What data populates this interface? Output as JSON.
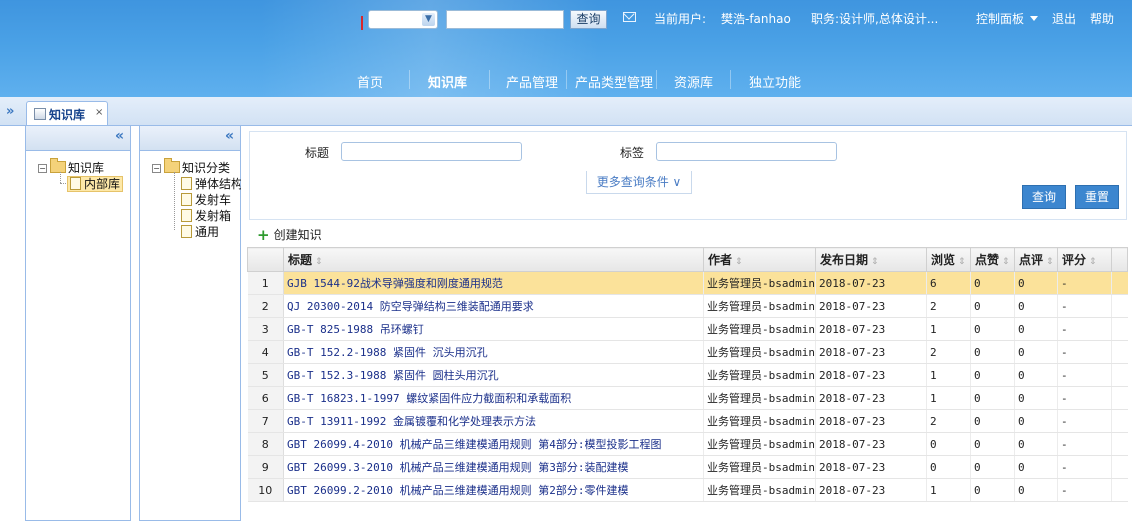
{
  "header": {
    "search_button": "查询",
    "user_label": "当前用户:",
    "user_name": "樊浩-fanhao",
    "role": "职务:设计师,总体设计...",
    "control_panel": "控制面板",
    "logout": "退出",
    "help": "帮助",
    "nav": [
      "首页",
      "知识库",
      "产品管理",
      "产品类型管理",
      "资源库",
      "独立功能"
    ],
    "active_nav": "知识库"
  },
  "tabs": [
    {
      "label": "知识库",
      "close": "×"
    }
  ],
  "left_tree": {
    "root": "知识库",
    "children": [
      "内部库"
    ],
    "selected": "内部库"
  },
  "category_tree": {
    "root": "知识分类",
    "children": [
      "弹体结构",
      "发射车",
      "发射箱",
      "通用"
    ]
  },
  "filter": {
    "title_label": "标题",
    "title_value": "",
    "tag_label": "标签",
    "tag_value": "",
    "more_conditions": "更多查询条件 ∨",
    "query_button": "查询",
    "reset_button": "重置"
  },
  "create_label": "创建知识",
  "grid": {
    "columns": [
      "标题",
      "作者",
      "发布日期",
      "浏览",
      "点赞",
      "点评",
      "评分"
    ],
    "rows": [
      {
        "n": "1",
        "title": "GJB 1544-92战术导弹强度和刚度通用规范",
        "author": "业务管理员-bsadmin",
        "date": "2018-07-23",
        "views": "6",
        "likes": "0",
        "comments": "0",
        "score": "-"
      },
      {
        "n": "2",
        "title": "QJ 20300-2014 防空导弹结构三维装配通用要求",
        "author": "业务管理员-bsadmin",
        "date": "2018-07-23",
        "views": "2",
        "likes": "0",
        "comments": "0",
        "score": "-"
      },
      {
        "n": "3",
        "title": "GB-T 825-1988 吊环螺钉",
        "author": "业务管理员-bsadmin",
        "date": "2018-07-23",
        "views": "1",
        "likes": "0",
        "comments": "0",
        "score": "-"
      },
      {
        "n": "4",
        "title": "GB-T 152.2-1988 紧固件 沉头用沉孔",
        "author": "业务管理员-bsadmin",
        "date": "2018-07-23",
        "views": "2",
        "likes": "0",
        "comments": "0",
        "score": "-"
      },
      {
        "n": "5",
        "title": "GB-T 152.3-1988 紧固件 圆柱头用沉孔",
        "author": "业务管理员-bsadmin",
        "date": "2018-07-23",
        "views": "1",
        "likes": "0",
        "comments": "0",
        "score": "-"
      },
      {
        "n": "6",
        "title": "GB-T 16823.1-1997 螺纹紧固件应力截面积和承载面积",
        "author": "业务管理员-bsadmin",
        "date": "2018-07-23",
        "views": "1",
        "likes": "0",
        "comments": "0",
        "score": "-"
      },
      {
        "n": "7",
        "title": "GB-T 13911-1992 金属镀覆和化学处理表示方法",
        "author": "业务管理员-bsadmin",
        "date": "2018-07-23",
        "views": "2",
        "likes": "0",
        "comments": "0",
        "score": "-"
      },
      {
        "n": "8",
        "title": "GBT 26099.4-2010 机械产品三维建模通用规则 第4部分:模型投影工程图",
        "author": "业务管理员-bsadmin",
        "date": "2018-07-23",
        "views": "0",
        "likes": "0",
        "comments": "0",
        "score": "-"
      },
      {
        "n": "9",
        "title": "GBT 26099.3-2010 机械产品三维建模通用规则 第3部分:装配建模",
        "author": "业务管理员-bsadmin",
        "date": "2018-07-23",
        "views": "0",
        "likes": "0",
        "comments": "0",
        "score": "-"
      },
      {
        "n": "10",
        "title": "GBT 26099.2-2010 机械产品三维建模通用规则 第2部分:零件建模",
        "author": "业务管理员-bsadmin",
        "date": "2018-07-23",
        "views": "1",
        "likes": "0",
        "comments": "0",
        "score": "-"
      }
    ],
    "selected_row": "1"
  }
}
